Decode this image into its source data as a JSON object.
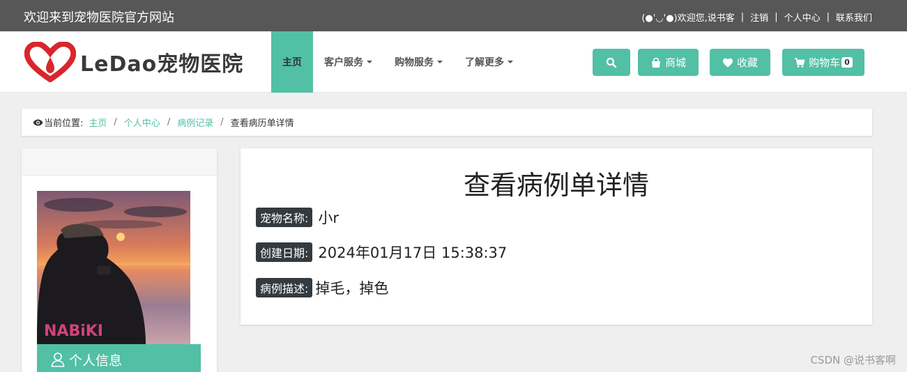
{
  "topbar": {
    "welcome": "欢迎来到宠物医院官方网站",
    "greeting": "(●'◡'●)欢迎您,说书客",
    "logout": "注销",
    "personal_center": "个人中心",
    "contact": "联系我们",
    "separator": "|"
  },
  "logo": {
    "text": "LeDao宠物医院"
  },
  "menu": {
    "home": "主页",
    "customer_service": "客户服务",
    "shopping_service": "购物服务",
    "learn_more": "了解更多"
  },
  "buttons": {
    "mall": "商城",
    "favorites": "收藏",
    "cart": "购物车",
    "cart_count": "0"
  },
  "icons": [
    "search-icon",
    "bag-icon",
    "heart-icon",
    "cart-icon",
    "eye-icon",
    "user-icon",
    "chevron-down-icon"
  ],
  "breadcrumb": {
    "label": "当前位置:",
    "items": [
      "主页",
      "个人中心",
      "病例记录"
    ],
    "current": "查看病历单详情",
    "separator": "/"
  },
  "sidebar": {
    "personal_info": "个人信息"
  },
  "detail": {
    "title": "查看病例单详情",
    "pet_name_label": "宠物名称:",
    "pet_name": "小r",
    "created_label": "创建日期:",
    "created": "2024年01月17日 15:38:37",
    "desc_label": "病例描述:",
    "desc": "掉毛，掉色"
  },
  "watermark": "CSDN @说书客啊",
  "colors": {
    "accent": "#52c0a5",
    "topbar": "#575757",
    "tag": "#333a40"
  }
}
